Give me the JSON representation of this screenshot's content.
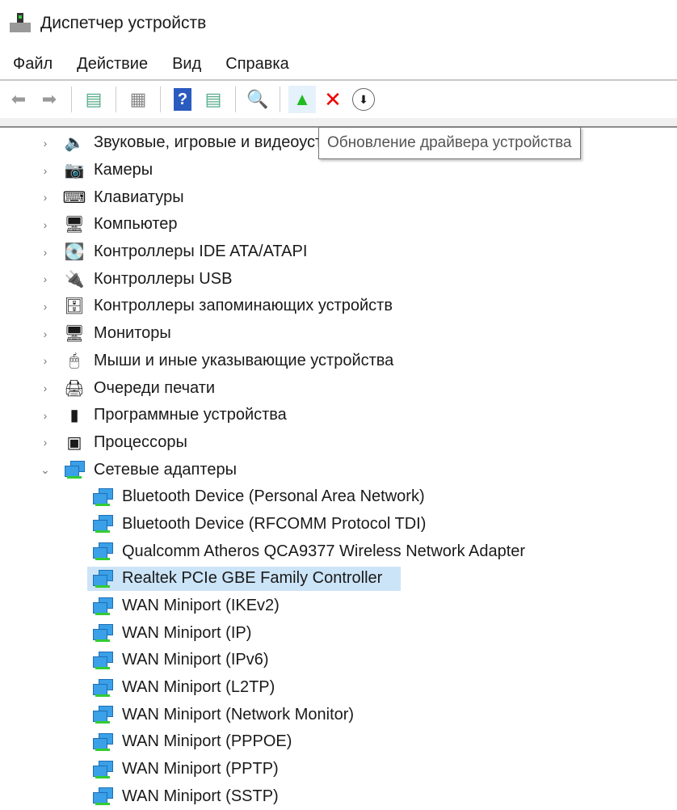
{
  "window": {
    "title": "Диспетчер устройств"
  },
  "menu": [
    "Файл",
    "Действие",
    "Вид",
    "Справка"
  ],
  "tooltip": "Обновление драйвера устройства",
  "categories": [
    {
      "label": "Звуковые, игровые и видеоустройства",
      "icon": "🔈"
    },
    {
      "label": "Камеры",
      "icon": "📷"
    },
    {
      "label": "Клавиатуры",
      "icon": "⌨"
    },
    {
      "label": "Компьютер",
      "icon": "🖥"
    },
    {
      "label": "Контроллеры IDE ATA/ATAPI",
      "icon": "💽"
    },
    {
      "label": "Контроллеры USB",
      "icon": "🔌"
    },
    {
      "label": "Контроллеры запоминающих устройств",
      "icon": "🗄"
    },
    {
      "label": "Мониторы",
      "icon": "🖥"
    },
    {
      "label": "Мыши и иные указывающие устройства",
      "icon": "🖱"
    },
    {
      "label": "Очереди печати",
      "icon": "🖨"
    },
    {
      "label": "Программные устройства",
      "icon": "▮"
    },
    {
      "label": "Процессоры",
      "icon": "▣"
    },
    {
      "label": "Сетевые адаптеры",
      "icon": "network"
    }
  ],
  "network_adapters": [
    "Bluetooth Device (Personal Area Network)",
    "Bluetooth Device (RFCOMM Protocol TDI)",
    "Qualcomm Atheros QCA9377 Wireless Network Adapter",
    "Realtek PCIe GBE Family Controller",
    "WAN Miniport (IKEv2)",
    "WAN Miniport (IP)",
    "WAN Miniport (IPv6)",
    "WAN Miniport (L2TP)",
    "WAN Miniport (Network Monitor)",
    "WAN Miniport (PPPOE)",
    "WAN Miniport (PPTP)",
    "WAN Miniport (SSTP)"
  ],
  "selected_adapter": "Realtek PCIe GBE Family Controller"
}
